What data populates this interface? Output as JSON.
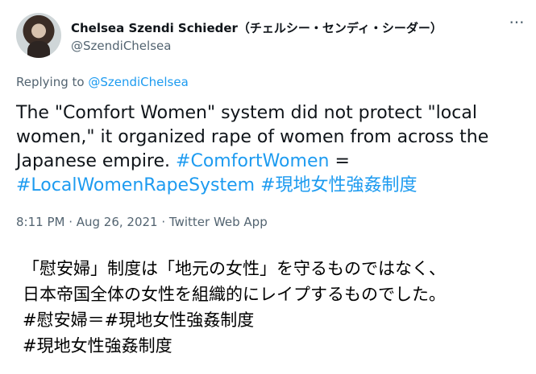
{
  "tweet": {
    "author": {
      "display_name": "Chelsea Szendi Schieder（チェルシー・センディ・シーダー）",
      "handle": "@SzendiChelsea",
      "avatar_icon": "profile-photo"
    },
    "more_icon": "···",
    "reply_prefix": "Replying to",
    "reply_to": "@SzendiChelsea",
    "text": {
      "plain": "The \"Comfort Women\" system did not protect \"local women,\" it  organized rape of women from across the Japanese empire.",
      "hashtag_1": "#ComfortWomen",
      "separator": "=",
      "hashtag_2": "#LocalWomenRapeSystem",
      "hashtag_3": "#現地女性強姦制度"
    },
    "timestamp": "8:11 PM · Aug 26, 2021 · Twitter Web App"
  },
  "translation": {
    "line_1": "「慰安婦」制度は「地元の女性」を守るものではなく、",
    "line_2": "日本帝国全体の女性を組織的にレイプするものでした。",
    "line_3": "#慰安婦＝#現地女性強姦制度",
    "line_4": "#現地女性強姦制度"
  },
  "colors": {
    "link": "#1d9bf0",
    "secondary_text": "#536471",
    "primary_text": "#0f1419"
  }
}
